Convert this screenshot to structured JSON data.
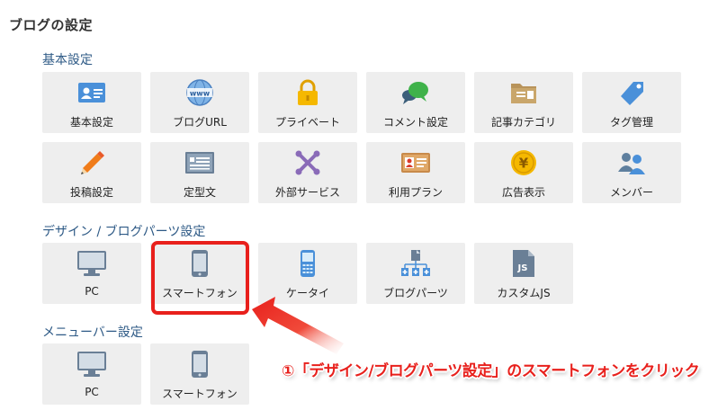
{
  "page_title": "ブログの設定",
  "sections": {
    "basic": {
      "title": "基本設定"
    },
    "design": {
      "title": "デザイン / ブログパーツ設定"
    },
    "menubar": {
      "title": "メニューバー設定"
    }
  },
  "basic_tiles": [
    {
      "label": "基本設定",
      "icon": "id-card-icon"
    },
    {
      "label": "ブログURL",
      "icon": "www-globe-icon"
    },
    {
      "label": "プライベート",
      "icon": "padlock-icon"
    },
    {
      "label": "コメント設定",
      "icon": "speech-bubble-icon"
    },
    {
      "label": "記事カテゴリ",
      "icon": "folder-icon"
    },
    {
      "label": "タグ管理",
      "icon": "tag-icon"
    },
    {
      "label": "投稿設定",
      "icon": "pencil-icon"
    },
    {
      "label": "定型文",
      "icon": "template-card-icon"
    },
    {
      "label": "外部サービス",
      "icon": "joomla-link-icon"
    },
    {
      "label": "利用プラン",
      "icon": "member-card-icon"
    },
    {
      "label": "広告表示",
      "icon": "yen-coin-icon"
    },
    {
      "label": "メンバー",
      "icon": "users-icon"
    }
  ],
  "design_tiles": [
    {
      "label": "PC",
      "icon": "monitor-icon"
    },
    {
      "label": "スマートフォン",
      "icon": "smartphone-icon"
    },
    {
      "label": "ケータイ",
      "icon": "feature-phone-icon"
    },
    {
      "label": "ブログパーツ",
      "icon": "blog-parts-icon"
    },
    {
      "label": "カスタムJS",
      "icon": "js-file-icon"
    }
  ],
  "menubar_tiles": [
    {
      "label": "PC",
      "icon": "monitor-icon"
    },
    {
      "label": "スマートフォン",
      "icon": "smartphone-icon"
    }
  ],
  "annotation": {
    "text": "①「デザイン/ブログパーツ設定」のスマートフォンをクリック",
    "color": "#e8201c"
  },
  "colors": {
    "section_title": "#2e5a86",
    "tile_bg": "#eeeeee",
    "icon_blue": "#4a90d9",
    "highlight": "#e8201c"
  }
}
